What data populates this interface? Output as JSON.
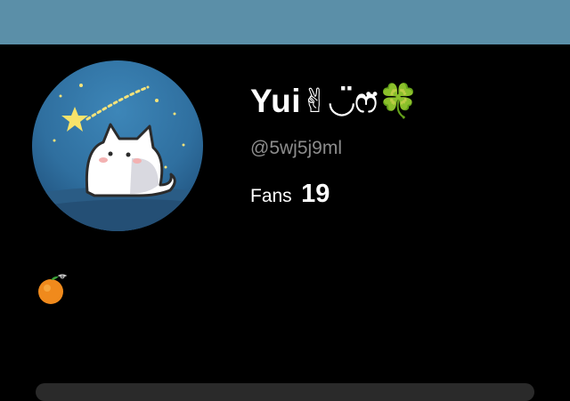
{
  "colors": {
    "topbar": "#5b8fa8",
    "background": "#000000",
    "name_text": "#ffffff",
    "handle_text": "#8d8d8d"
  },
  "profile": {
    "name": "Yui✌︎◡̈ෆ̈🍀",
    "handle": "@5wj5j9ml",
    "fans_label": "Fans",
    "fans_count": "19"
  },
  "avatar": {
    "icon": "cat-under-starry-sky-avatar"
  },
  "bio": {
    "icon": "tangerine-emoji"
  }
}
